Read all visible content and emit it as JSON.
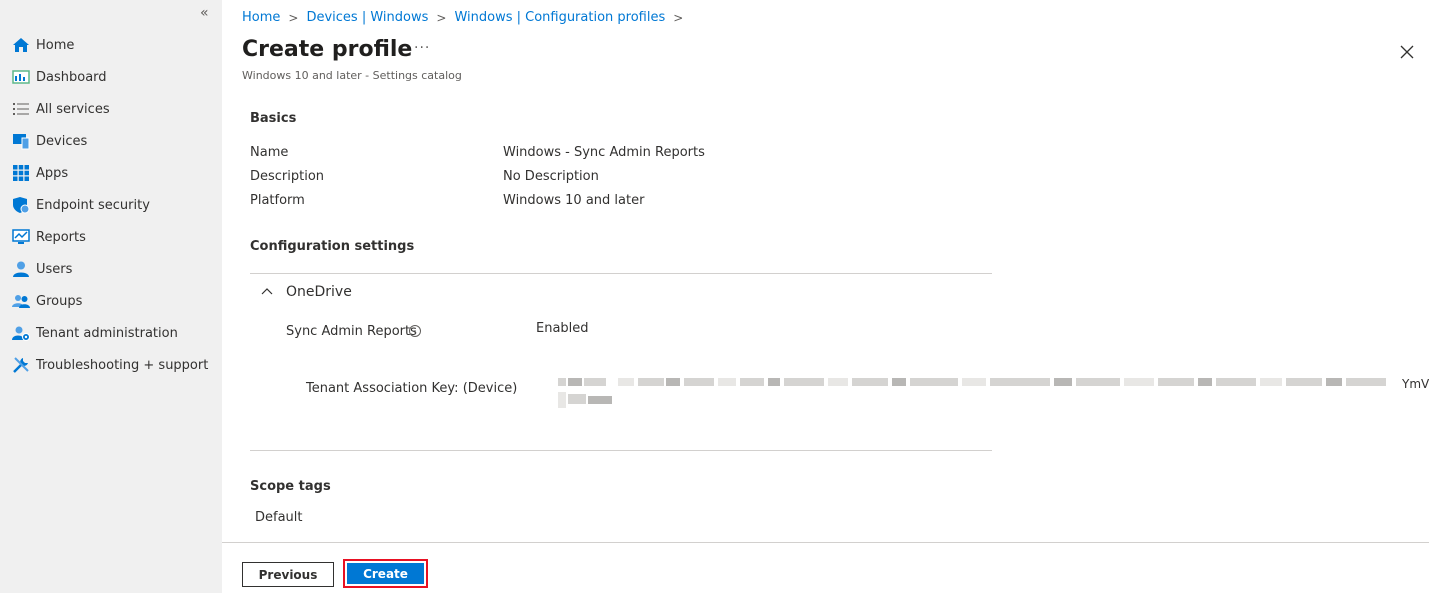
{
  "sidebar": {
    "collapse_glyph": "«",
    "items": [
      {
        "label": "Home",
        "icon": "home-icon"
      },
      {
        "label": "Dashboard",
        "icon": "dashboard-icon"
      },
      {
        "label": "All services",
        "icon": "list-icon"
      },
      {
        "label": "Devices",
        "icon": "devices-icon"
      },
      {
        "label": "Apps",
        "icon": "apps-icon"
      },
      {
        "label": "Endpoint security",
        "icon": "shield-icon"
      },
      {
        "label": "Reports",
        "icon": "reports-icon"
      },
      {
        "label": "Users",
        "icon": "user-icon"
      },
      {
        "label": "Groups",
        "icon": "groups-icon"
      },
      {
        "label": "Tenant administration",
        "icon": "tenant-admin-icon"
      },
      {
        "label": "Troubleshooting + support",
        "icon": "tools-icon"
      }
    ]
  },
  "breadcrumb": {
    "items": [
      "Home",
      "Devices | Windows",
      "Windows | Configuration profiles"
    ],
    "separator": ">"
  },
  "header": {
    "title": "Create profile",
    "more": "···",
    "subtitle": "Windows 10 and later - Settings catalog"
  },
  "basics": {
    "title": "Basics",
    "rows": [
      {
        "label": "Name",
        "value": "Windows - Sync Admin Reports"
      },
      {
        "label": "Description",
        "value": "No Description"
      },
      {
        "label": "Platform",
        "value": "Windows 10 and later"
      }
    ]
  },
  "config": {
    "title": "Configuration settings",
    "group": "OneDrive",
    "setting_label": "Sync Admin Reports",
    "setting_value": "Enabled",
    "key_label": "Tenant Association Key: (Device)",
    "key_value_tail": "YmV"
  },
  "scope": {
    "title": "Scope tags",
    "value": "Default"
  },
  "footer": {
    "previous_label": "Previous",
    "create_label": "Create"
  },
  "colors": {
    "accent": "#0078d4",
    "highlight": "#e81123",
    "sidebar_bg": "#f0f0f0"
  }
}
